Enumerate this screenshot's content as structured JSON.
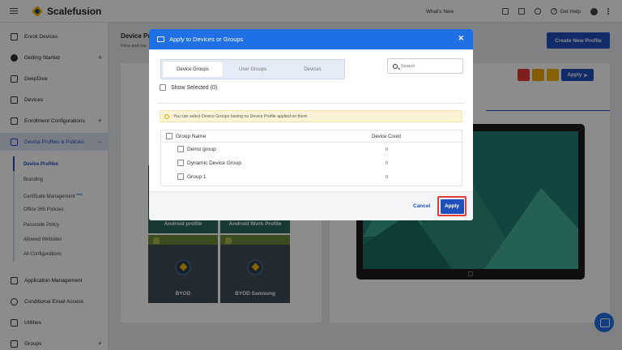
{
  "app": {
    "name": "Scalefusion"
  },
  "topbar": {
    "whats_new": "What's New",
    "help": "Get Help"
  },
  "sidebar": {
    "items": [
      {
        "label": "Enroll Devices",
        "icon": "enroll-icon"
      },
      {
        "label": "Getting Started",
        "icon": "rocket-icon"
      },
      {
        "label": "DeepDive",
        "icon": "bar-chart-icon"
      },
      {
        "label": "Devices",
        "icon": "devices-icon"
      },
      {
        "label": "Enrollment Configurations",
        "icon": "enrollment-config-icon"
      },
      {
        "label": "Device Profiles & Policies",
        "icon": "device-profile-icon"
      },
      {
        "label": "Application Management",
        "icon": "grid-icon"
      },
      {
        "label": "Conditional Email Access",
        "icon": "at-icon"
      },
      {
        "label": "Utilities",
        "icon": "sliders-icon"
      },
      {
        "label": "Groups",
        "icon": "groups-icon"
      }
    ],
    "sub_items": [
      "Device Profiles",
      "Branding",
      "Certificate Management",
      "Office 365 Policies",
      "Passcode Policy",
      "Allowed Websites",
      "All Configurations"
    ],
    "new_badge": "New"
  },
  "main": {
    "title": "Device Pro",
    "subtitle": "View and ma",
    "create_button": "Create New Profile",
    "apply_button": "Apply",
    "tiles": [
      {
        "top_label": "Android profile",
        "label": ""
      },
      {
        "top_label": "Android Work Profile",
        "label": ""
      },
      {
        "top_label": "",
        "label": "BYOD"
      },
      {
        "top_label": "",
        "label": "BYOD Samsung"
      }
    ]
  },
  "modal": {
    "title": "Apply to Devices or Groups",
    "tabs": [
      "Device Groups",
      "User Groups",
      "Devices"
    ],
    "search_placeholder": "Search",
    "show_selected": "Show Selected (0)",
    "info": "You can select Device Groups having no Device Profile applied on them.",
    "table": {
      "col_name": "Group Name",
      "col_count": "Device Count",
      "rows": [
        {
          "name": "Demo group",
          "count": "0"
        },
        {
          "name": "Dynamic Device Group",
          "count": "0"
        },
        {
          "name": "Group 1",
          "count": "0"
        }
      ]
    },
    "cancel": "Cancel",
    "apply": "Apply"
  },
  "colors": {
    "primary": "#1f4fbf",
    "header": "#1f6fe5",
    "highlight": "#e53935"
  }
}
